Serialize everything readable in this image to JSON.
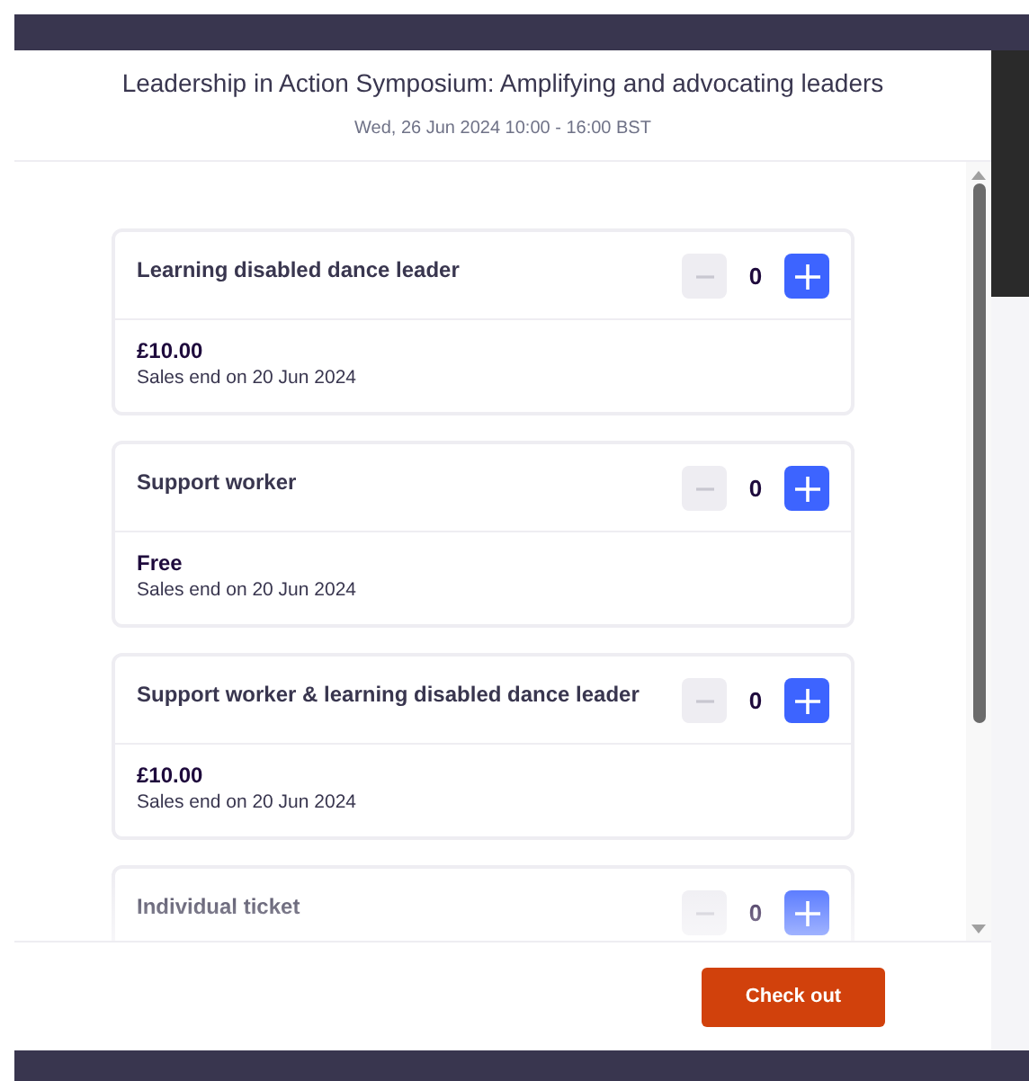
{
  "modal": {
    "title": "Leadership in Action Symposium: Amplifying and advocating leaders",
    "date": "Wed, 26 Jun 2024 10:00 - 16:00 BST"
  },
  "tickets": [
    {
      "name": "Learning disabled dance leader",
      "quantity": "0",
      "decrease_disabled": true,
      "price": "£10.00",
      "sales_end": "Sales end on 20 Jun 2024"
    },
    {
      "name": "Support worker",
      "quantity": "0",
      "decrease_disabled": true,
      "price": "Free",
      "sales_end": "Sales end on 20 Jun 2024"
    },
    {
      "name": "Support worker & learning disabled dance leader",
      "quantity": "0",
      "decrease_disabled": true,
      "price": "£10.00",
      "sales_end": "Sales end on 20 Jun 2024"
    },
    {
      "name": "Individual ticket",
      "quantity": "0",
      "decrease_disabled": true
    }
  ],
  "checkout_button": "Check out"
}
